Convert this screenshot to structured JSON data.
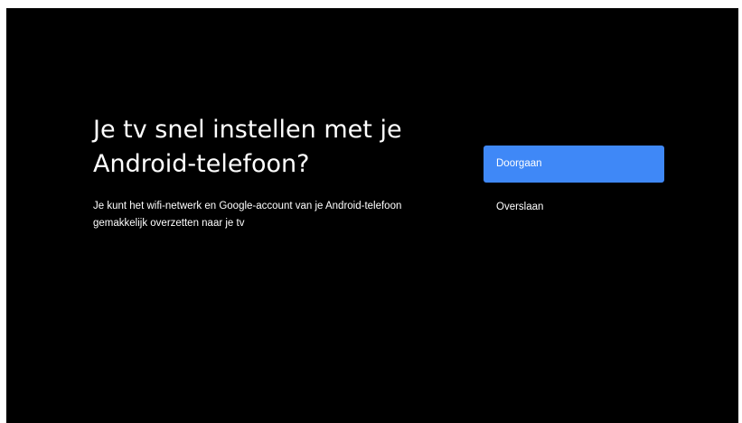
{
  "setup": {
    "title": "Je tv snel instellen met je Android-telefoon?",
    "subtitle": "Je kunt het wifi-netwerk en Google-account van je Android-telefoon gemakkelijk overzetten naar je tv",
    "actions": {
      "continue_label": "Doorgaan",
      "skip_label": "Overslaan"
    }
  },
  "colors": {
    "background": "#000000",
    "text": "#ffffff",
    "accent": "#3f88f7"
  }
}
